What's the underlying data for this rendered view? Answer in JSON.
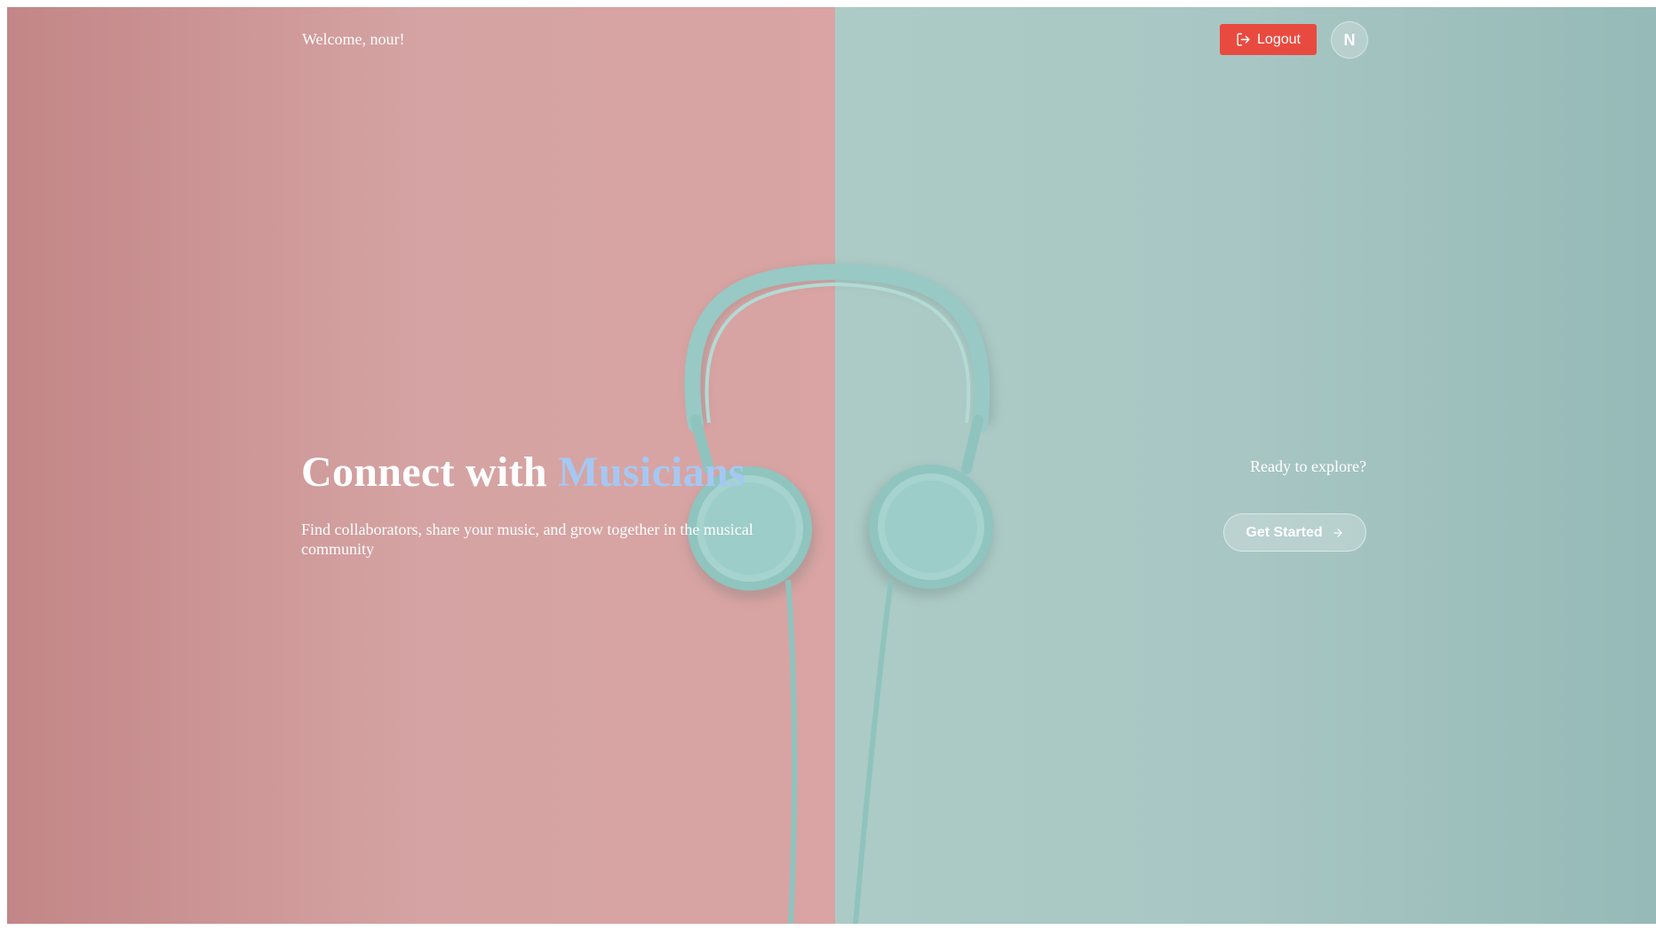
{
  "header": {
    "welcome_text": "Welcome, nour!",
    "logout_label": "Logout",
    "avatar_initial": "N"
  },
  "hero": {
    "title_prefix": "Connect with ",
    "title_accent": "Musicians",
    "subtitle": "Find collaborators, share your music, and grow together in the musical community"
  },
  "cta": {
    "prompt": "Ready to explore?",
    "button_label": "Get Started"
  },
  "icons": {
    "logout": "logout-icon",
    "arrow": "arrow-right-icon"
  },
  "colors": {
    "logout_bg": "#e94a3f",
    "accent_text": "#a5c8f2",
    "bg_left": "#d5a3a3",
    "bg_right": "#a8c6c3"
  }
}
